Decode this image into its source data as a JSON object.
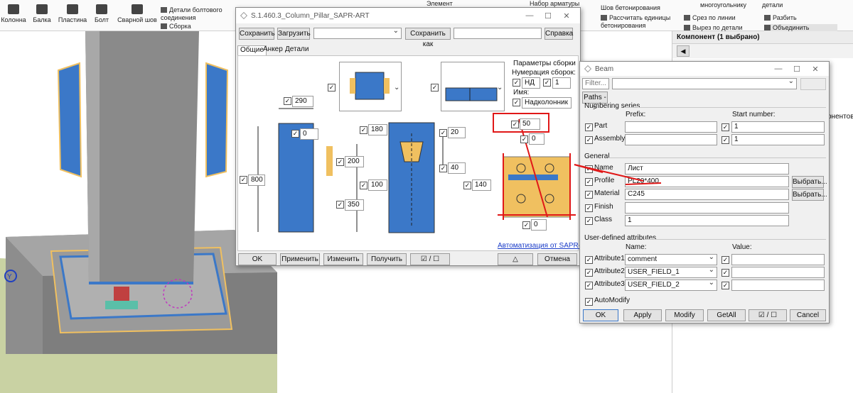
{
  "ribbon": {
    "items": [
      {
        "label": "Колонна"
      },
      {
        "label": "Балка"
      },
      {
        "label": "Пластина"
      },
      {
        "label": "Болт"
      },
      {
        "label": "Сварной шов"
      }
    ],
    "bolt_details": "Детали болтового соединения",
    "assembly": "Сборка",
    "element": "Элемент",
    "rebar_set": "Набор арматуры",
    "concrete_seam": "Шов бетонирования",
    "calc_concrete_units": "Рассчитать единицы бетонирования",
    "rect_cut": "многоугольнику",
    "details": "детали",
    "line_cut": "Срез по линии",
    "detail_cut": "Вырез по детали",
    "split": "Разбить",
    "merge": "Объединить"
  },
  "right_panel": {
    "header": "Компонент (1 выбрано)",
    "back_glyph": "◀",
    "side_text": "онентов"
  },
  "main_dialog": {
    "title": "S.1.460.3_Column_Pillar_SAPR-ART",
    "save": "Сохранить",
    "load": "Загрузить",
    "save_as": "Сохранить как",
    "help": "Справка",
    "tabs": [
      "Общие",
      "Анкер",
      "Детали"
    ],
    "assembly_params": "Параметры сборки",
    "assembly_numbering": "Нумерация сборок:",
    "prefix_value": "НД",
    "start_value": "1",
    "name_label": "Имя:",
    "name_value": "Надколонник",
    "dims": {
      "d290": "290",
      "d0a": "0",
      "d200": "200",
      "d350": "350",
      "d800": "800",
      "d180": "180",
      "d20": "20",
      "d40": "40",
      "d100": "100",
      "d50": "50",
      "d0b": "0",
      "d140": "140",
      "d0c": "0"
    },
    "automation_link": "Автоматизация от SAPR-ART",
    "ok": "OK",
    "apply": "Применить",
    "modify": "Изменить",
    "get": "Получить",
    "toggle": "☑ / ☐",
    "warn": "△",
    "cancel": "Отмена"
  },
  "beam_dialog": {
    "title": "Beam",
    "filter_placeholder": "Filter...",
    "paths": "Paths ->",
    "numbering_series": "Numbering series",
    "prefix_col": "Prefix:",
    "start_col": "Start number:",
    "part_label": "Part",
    "assembly_label": "Assembly",
    "part_start": "1",
    "assembly_start": "1",
    "general": "General",
    "name_label": "Name",
    "name_value": "Лист",
    "profile_label": "Profile",
    "profile_value": "PL20*400",
    "material_label": "Material",
    "material_value": "C245",
    "finish_label": "Finish",
    "class_label": "Class",
    "class_value": "1",
    "select": "Выбрать...",
    "uda": "User-defined attributes",
    "name_col": "Name:",
    "value_col": "Value:",
    "attributes": [
      {
        "label": "Attribute1",
        "name": "comment"
      },
      {
        "label": "Attribute2",
        "name": "USER_FIELD_1"
      },
      {
        "label": "Attribute3",
        "name": "USER_FIELD_2"
      }
    ],
    "automodify": "AutoModify",
    "ok": "OK",
    "apply": "Apply",
    "modify": "Modify",
    "getall": "GetAll",
    "toggle": "☑ / ☐",
    "cancel": "Cancel"
  },
  "colors": {
    "accent_blue": "#3b78c8",
    "plate_yellow": "#f0c060",
    "annotation_red": "#e01818",
    "concrete": "#a9a9a9",
    "ground": "#c9d2a3"
  }
}
